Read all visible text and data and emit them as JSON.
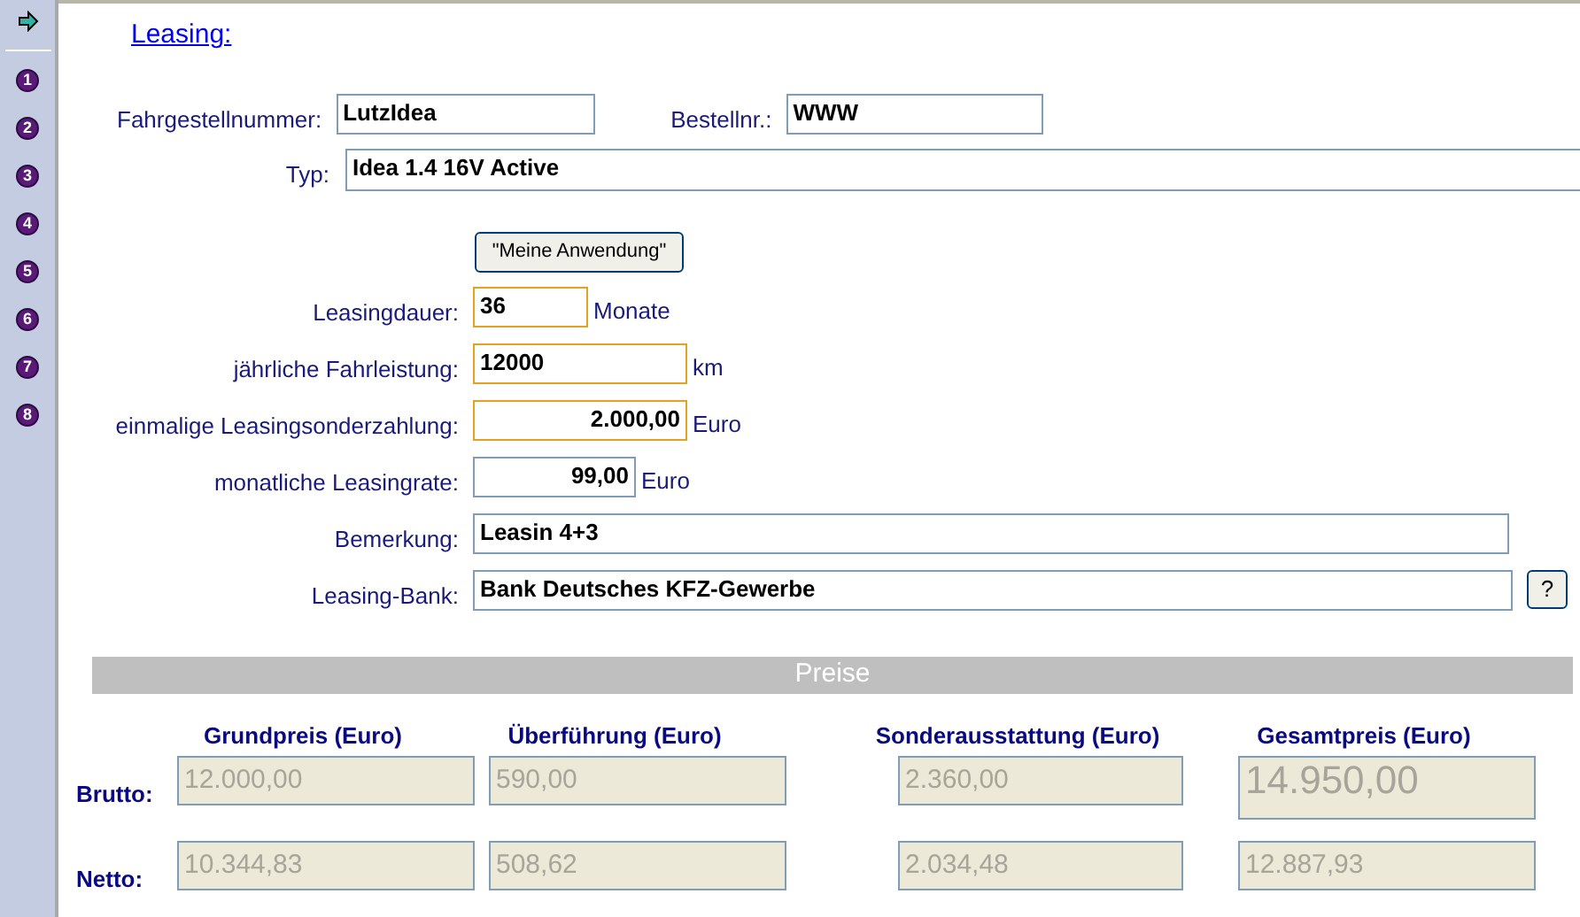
{
  "sidebar": {
    "items": [
      {
        "label": "1"
      },
      {
        "label": "2"
      },
      {
        "label": "3"
      },
      {
        "label": "4"
      },
      {
        "label": "5"
      },
      {
        "label": "6"
      },
      {
        "label": "7"
      },
      {
        "label": "8"
      }
    ]
  },
  "title": "Leasing:",
  "vehicle": {
    "chassis": {
      "label": "Fahrgestellnummer:",
      "value": "LutzIdea"
    },
    "order": {
      "label": "Bestellnr.:",
      "value": "WWW"
    },
    "type": {
      "label": "Typ:",
      "value": "Idea 1.4 16V Active"
    }
  },
  "app_button": "\"Meine Anwendung\"",
  "leasing_fields": [
    {
      "kind": "text",
      "label": "Leasingdauer:",
      "value": "36",
      "unit": "Monate",
      "highlighted": true
    },
    {
      "kind": "text",
      "label": "jährliche Fahrleistung:",
      "value": "12000",
      "unit": "km",
      "highlighted": true
    },
    {
      "kind": "amount",
      "label": "einmalige Leasingsonderzahlung:",
      "value": "2.000,00",
      "unit": "Euro",
      "highlighted": true
    },
    {
      "kind": "amount",
      "label": "monatliche Leasingrate:",
      "value": "99,00",
      "unit": "Euro",
      "highlighted": false
    },
    {
      "kind": "wide",
      "label": "Bemerkung:",
      "value": "Leasin 4+3",
      "highlighted": false
    },
    {
      "kind": "lookup",
      "label": "Leasing-Bank:",
      "value": "Bank Deutsches KFZ-Gewerbe",
      "button": "?",
      "highlighted": false
    }
  ],
  "prices": {
    "title": "Preise",
    "columns": [
      "Grundpreis (Euro)",
      "Überführung (Euro)",
      "Sonderausstattung (Euro)",
      "Gesamtpreis (Euro)"
    ],
    "rows": [
      {
        "label": "Brutto:",
        "values": [
          "12.000,00",
          "590,00",
          "2.360,00",
          "14.950,00"
        ]
      },
      {
        "label": "Netto:",
        "values": [
          "10.344,83",
          "508,62",
          "2.034,48",
          "12.887,93"
        ]
      }
    ]
  }
}
